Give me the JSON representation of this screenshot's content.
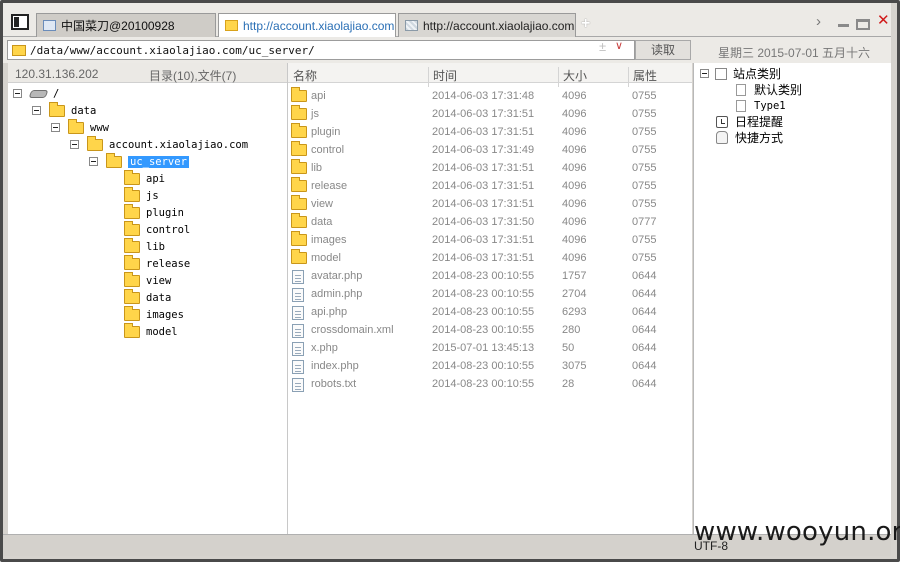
{
  "tabs": [
    {
      "label": "中国菜刀@20100928",
      "icon": "window-icon"
    },
    {
      "label": "http://account.xiaolajiao.com...",
      "icon": "folder-icon"
    },
    {
      "label": "http://account.xiaolajiao.com...",
      "icon": "network-icon"
    }
  ],
  "tab_add_label": "+",
  "window_controls": {
    "next": "›",
    "close": "✕"
  },
  "address": {
    "path": "/data/www/account.xiaolajiao.com/uc_server/",
    "plus_minus": "±",
    "dropdown": "∨",
    "read_button": "读取",
    "datetime": "星期三 2015-07-01 五月十六"
  },
  "left_header": {
    "ip": "120.31.136.202",
    "counts": "目录(10),文件(7)"
  },
  "tree": {
    "root": "/",
    "path_nodes": [
      "data",
      "www",
      "account.xiaolajiao.com"
    ],
    "selected": "uc_server",
    "children": [
      "api",
      "js",
      "plugin",
      "control",
      "lib",
      "release",
      "view",
      "data",
      "images",
      "model"
    ]
  },
  "file_columns": {
    "name": "名称",
    "time": "时间",
    "size": "大小",
    "attr": "属性"
  },
  "files": [
    {
      "name": "api",
      "time": "2014-06-03 17:31:48",
      "size": "4096",
      "attr": "0755",
      "type": "folder"
    },
    {
      "name": "js",
      "time": "2014-06-03 17:31:51",
      "size": "4096",
      "attr": "0755",
      "type": "folder"
    },
    {
      "name": "plugin",
      "time": "2014-06-03 17:31:51",
      "size": "4096",
      "attr": "0755",
      "type": "folder"
    },
    {
      "name": "control",
      "time": "2014-06-03 17:31:49",
      "size": "4096",
      "attr": "0755",
      "type": "folder"
    },
    {
      "name": "lib",
      "time": "2014-06-03 17:31:51",
      "size": "4096",
      "attr": "0755",
      "type": "folder"
    },
    {
      "name": "release",
      "time": "2014-06-03 17:31:51",
      "size": "4096",
      "attr": "0755",
      "type": "folder"
    },
    {
      "name": "view",
      "time": "2014-06-03 17:31:51",
      "size": "4096",
      "attr": "0755",
      "type": "folder"
    },
    {
      "name": "data",
      "time": "2014-06-03 17:31:50",
      "size": "4096",
      "attr": "0777",
      "type": "folder"
    },
    {
      "name": "images",
      "time": "2014-06-03 17:31:51",
      "size": "4096",
      "attr": "0755",
      "type": "folder"
    },
    {
      "name": "model",
      "time": "2014-06-03 17:31:51",
      "size": "4096",
      "attr": "0755",
      "type": "folder"
    },
    {
      "name": "avatar.php",
      "time": "2014-08-23 00:10:55",
      "size": "1757",
      "attr": "0644",
      "type": "file"
    },
    {
      "name": "admin.php",
      "time": "2014-08-23 00:10:55",
      "size": "2704",
      "attr": "0644",
      "type": "file"
    },
    {
      "name": "api.php",
      "time": "2014-08-23 00:10:55",
      "size": "6293",
      "attr": "0644",
      "type": "file"
    },
    {
      "name": "crossdomain.xml",
      "time": "2014-08-23 00:10:55",
      "size": "280",
      "attr": "0644",
      "type": "file"
    },
    {
      "name": "x.php",
      "time": "2015-07-01 13:45:13",
      "size": "50",
      "attr": "0644",
      "type": "file"
    },
    {
      "name": "index.php",
      "time": "2014-08-23 00:10:55",
      "size": "3075",
      "attr": "0644",
      "type": "file"
    },
    {
      "name": "robots.txt",
      "time": "2014-08-23 00:10:55",
      "size": "28",
      "attr": "0644",
      "type": "file"
    }
  ],
  "right_tree": {
    "root": "站点类别",
    "children": [
      "默认类别",
      "Type1"
    ],
    "schedule": "日程提醒",
    "shortcuts": "快捷方式"
  },
  "status": {
    "encoding": "UTF-8"
  },
  "watermark": "www.wooyun.org",
  "colors": {
    "selection": "#3399ff",
    "active_tab_text": "#2a6fb5",
    "close": "#d01818",
    "folder": "#ffd54a"
  }
}
